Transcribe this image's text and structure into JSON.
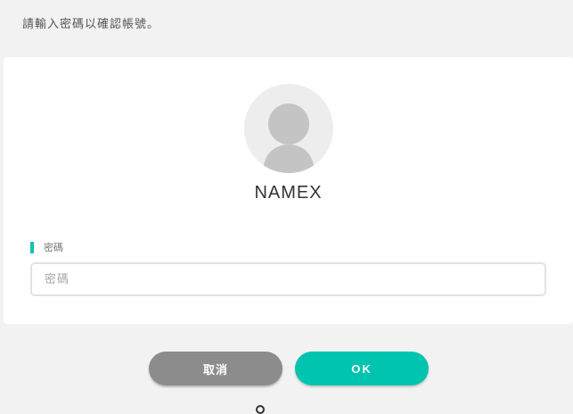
{
  "instruction_text": "請輸入密碼以確認帳號。",
  "account": {
    "username": "NAMEX",
    "avatar_icon": "default-user-avatar-icon"
  },
  "password": {
    "label": "密碼",
    "placeholder": "密碼",
    "value": ""
  },
  "actions": {
    "cancel_label": "取消",
    "ok_label": "OK"
  },
  "colors": {
    "accent": "#00c4b0",
    "cancel": "#8c8c8c",
    "background": "#f2f2f2",
    "card": "#ffffff"
  }
}
